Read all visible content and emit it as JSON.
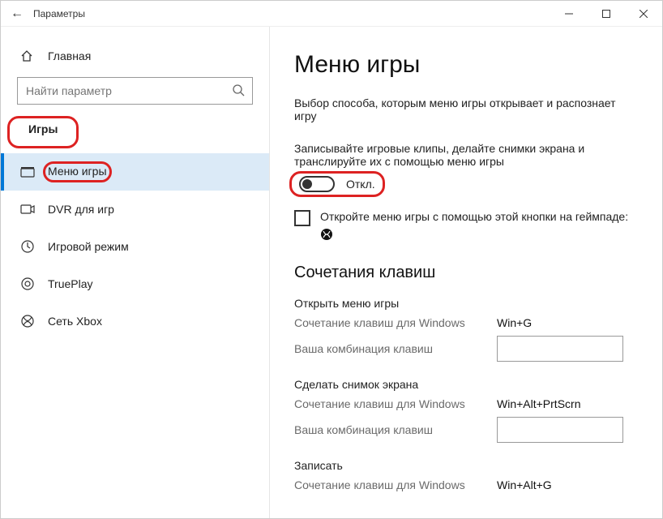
{
  "titlebar": {
    "title": "Параметры"
  },
  "sidebar": {
    "home": "Главная",
    "search_placeholder": "Найти параметр",
    "section": "Игры",
    "items": [
      {
        "label": "Меню игры"
      },
      {
        "label": "DVR для игр"
      },
      {
        "label": "Игровой режим"
      },
      {
        "label": "TruePlay"
      },
      {
        "label": "Сеть Xbox"
      }
    ]
  },
  "main": {
    "heading": "Меню игры",
    "description": "Выбор способа, которым меню игры открывает и распознает игру",
    "toggle_desc": "Записывайте игровые клипы, делайте снимки экрана и транслируйте их с помощью меню игры",
    "toggle_state": "Откл.",
    "checkbox_label": "Откройте меню игры с помощью этой кнопки на геймпаде:",
    "shortcuts_heading": "Сочетания клавиш",
    "win_label": "Сочетание клавиш для Windows",
    "your_label": "Ваша комбинация клавиш",
    "groups": [
      {
        "title": "Открыть меню игры",
        "win": "Win+G"
      },
      {
        "title": "Сделать снимок экрана",
        "win": "Win+Alt+PrtScrn"
      },
      {
        "title": "Записать",
        "win": "Win+Alt+G"
      }
    ]
  }
}
